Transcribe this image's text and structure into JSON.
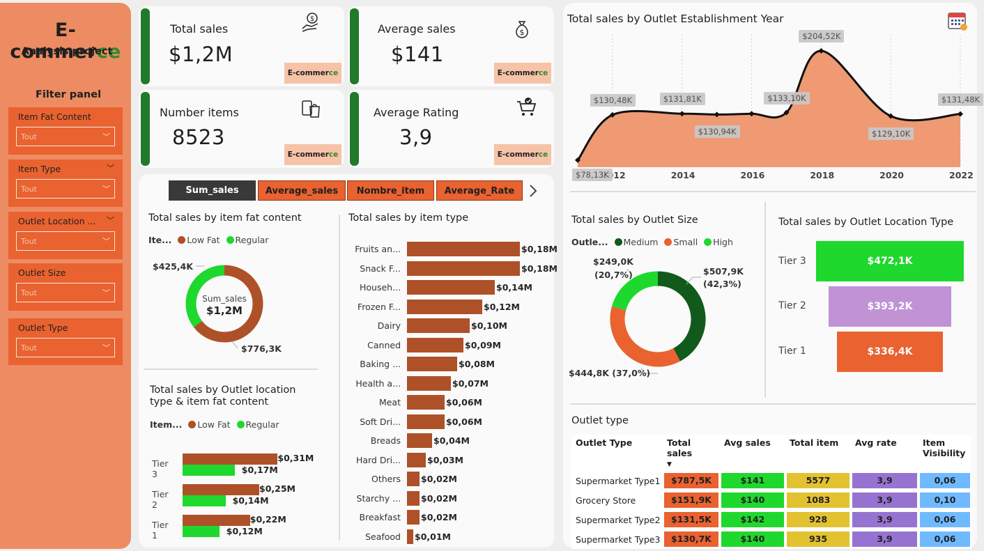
{
  "sidebar": {
    "brand_main": "E-commer",
    "brand_accent": "ce",
    "subtitle": "Analysis project",
    "filter_title": "Filter panel",
    "filters": [
      {
        "label": "Item Fat Content",
        "value": "Tout"
      },
      {
        "label": "Item Type",
        "value": "Tout"
      },
      {
        "label": "Outlet Location ...",
        "value": "Tout"
      },
      {
        "label": "Outlet Size",
        "value": "Tout"
      },
      {
        "label": "Outlet Type",
        "value": "Tout"
      }
    ]
  },
  "kpis": [
    {
      "label": "Total sales",
      "value": "$1,2M",
      "icon": "money-hand-icon"
    },
    {
      "label": "Average sales",
      "value": "$141",
      "icon": "money-bag-icon"
    },
    {
      "label": "Number items",
      "value": "8523",
      "icon": "shopping-bag-icon"
    },
    {
      "label": "Average Rating",
      "value": "3,9",
      "icon": "cart-check-icon"
    }
  ],
  "badge": {
    "main": "E-commer",
    "accent": "ce"
  },
  "tabs": [
    "Sum_sales",
    "Average_sales",
    "Nombre_item",
    "Average_Rate"
  ],
  "colors": {
    "orange": "#e96230",
    "brown": "#ae5129",
    "green": "#1fd82d",
    "darkgreen": "#115a1c",
    "purple": "#c193d5",
    "yellow": "#e2c231",
    "violet": "#9773d1",
    "blue": "#6fbaff",
    "area": "#ef9a72",
    "bar_green": "#207a2a"
  },
  "fat_donut": {
    "title": "Total sales by item fat content",
    "legend_title": "Ite...",
    "legend": [
      "Low Fat",
      "Regular"
    ],
    "center_label": "Sum_sales",
    "center_value": "$1,2M",
    "label_regular": "$425,4K",
    "label_lowfat": "$776,3K",
    "values": [
      776.3,
      425.4
    ]
  },
  "loc_fat": {
    "title_line1": "Total sales by Outlet location",
    "title_line2": "type & item fat content",
    "legend_title": "Item...",
    "legend": [
      "Low Fat",
      "Regular"
    ],
    "tiers": [
      {
        "tier": "Tier 3",
        "low": 0.31,
        "reg": 0.17,
        "low_label": "$0,31M",
        "reg_label": "$0,17M"
      },
      {
        "tier": "Tier 2",
        "low": 0.25,
        "reg": 0.14,
        "low_label": "$0,25M",
        "reg_label": "$0,14M"
      },
      {
        "tier": "Tier 1",
        "low": 0.22,
        "reg": 0.12,
        "low_label": "$0,22M",
        "reg_label": "$0,12M"
      }
    ]
  },
  "item_type": {
    "title": "Total sales by item type",
    "items": [
      {
        "label": "Fruits an...",
        "value": 0.18,
        "text": "$0,18M"
      },
      {
        "label": "Snack F...",
        "value": 0.18,
        "text": "$0,18M"
      },
      {
        "label": "Househ...",
        "value": 0.14,
        "text": "$0,14M"
      },
      {
        "label": "Frozen F...",
        "value": 0.12,
        "text": "$0,12M"
      },
      {
        "label": "Dairy",
        "value": 0.1,
        "text": "$0,10M"
      },
      {
        "label": "Canned",
        "value": 0.09,
        "text": "$0,09M"
      },
      {
        "label": "Baking ...",
        "value": 0.08,
        "text": "$0,08M"
      },
      {
        "label": "Health a...",
        "value": 0.07,
        "text": "$0,07M"
      },
      {
        "label": "Meat",
        "value": 0.06,
        "text": "$0,06M"
      },
      {
        "label": "Soft Dri...",
        "value": 0.06,
        "text": "$0,06M"
      },
      {
        "label": "Breads",
        "value": 0.04,
        "text": "$0,04M"
      },
      {
        "label": "Hard Dri...",
        "value": 0.03,
        "text": "$0,03M"
      },
      {
        "label": "Others",
        "value": 0.02,
        "text": "$0,02M"
      },
      {
        "label": "Starchy ...",
        "value": 0.02,
        "text": "$0,02M"
      },
      {
        "label": "Breakfast",
        "value": 0.02,
        "text": "$0,02M"
      },
      {
        "label": "Seafood",
        "value": 0.01,
        "text": "$0,01M"
      }
    ]
  },
  "chart_data": {
    "type": "area",
    "title": "Total sales by Outlet Establishment Year",
    "x": [
      2011,
      2012,
      2014,
      2015,
      2016,
      2017,
      2018,
      2020,
      2022
    ],
    "values": [
      78.13,
      130.48,
      131.81,
      130.94,
      131.81,
      133.1,
      204.52,
      129.1,
      131.48
    ],
    "labels": [
      "$78,13K",
      "$130,48K",
      "$131,81K",
      "$130,94K",
      "",
      "$133,10K",
      "$204,52K",
      "$129,10K",
      "$131,48K"
    ],
    "xticks": [
      "2012",
      "2014",
      "2016",
      "2018",
      "2020",
      "2022"
    ],
    "grid": true
  },
  "size_donut": {
    "title": "Total sales by Outlet Size",
    "legend_title": "Outle...",
    "legend": [
      "Medium",
      "Small",
      "High"
    ],
    "values": [
      507.9,
      444.8,
      249.0
    ],
    "label_medium_1": "$507,9K",
    "label_medium_2": "(42,3%)",
    "label_small": "$444,8K (37,0%)",
    "label_high_1": "$249,0K",
    "label_high_2": "(20,7%)"
  },
  "location": {
    "title": "Total sales by Outlet Location Type",
    "tiers": [
      {
        "tier": "Tier 3",
        "text": "$472,1K",
        "value": 472.1
      },
      {
        "tier": "Tier 2",
        "text": "$393,2K",
        "value": 393.2
      },
      {
        "tier": "Tier 1",
        "text": "$336,4K",
        "value": 336.4
      }
    ]
  },
  "outlet_type": {
    "title": "Outlet type",
    "headers": [
      "Outlet Type",
      "Total sales",
      "Avg sales",
      "Total item",
      "Avg rate",
      "Item Visibility"
    ],
    "rows": [
      {
        "name": "Supermarket Type1",
        "sales": "$787,5K",
        "avg": "$141",
        "items": "5577",
        "rate": "3,9",
        "vis": "0,06"
      },
      {
        "name": "Grocery Store",
        "sales": "$151,9K",
        "avg": "$140",
        "items": "1083",
        "rate": "3,9",
        "vis": "0,10"
      },
      {
        "name": "Supermarket Type2",
        "sales": "$131,5K",
        "avg": "$142",
        "items": "928",
        "rate": "3,9",
        "vis": "0,06"
      },
      {
        "name": "Supermarket Type3",
        "sales": "$130,7K",
        "avg": "$140",
        "items": "935",
        "rate": "3,9",
        "vis": "0,06"
      }
    ]
  }
}
